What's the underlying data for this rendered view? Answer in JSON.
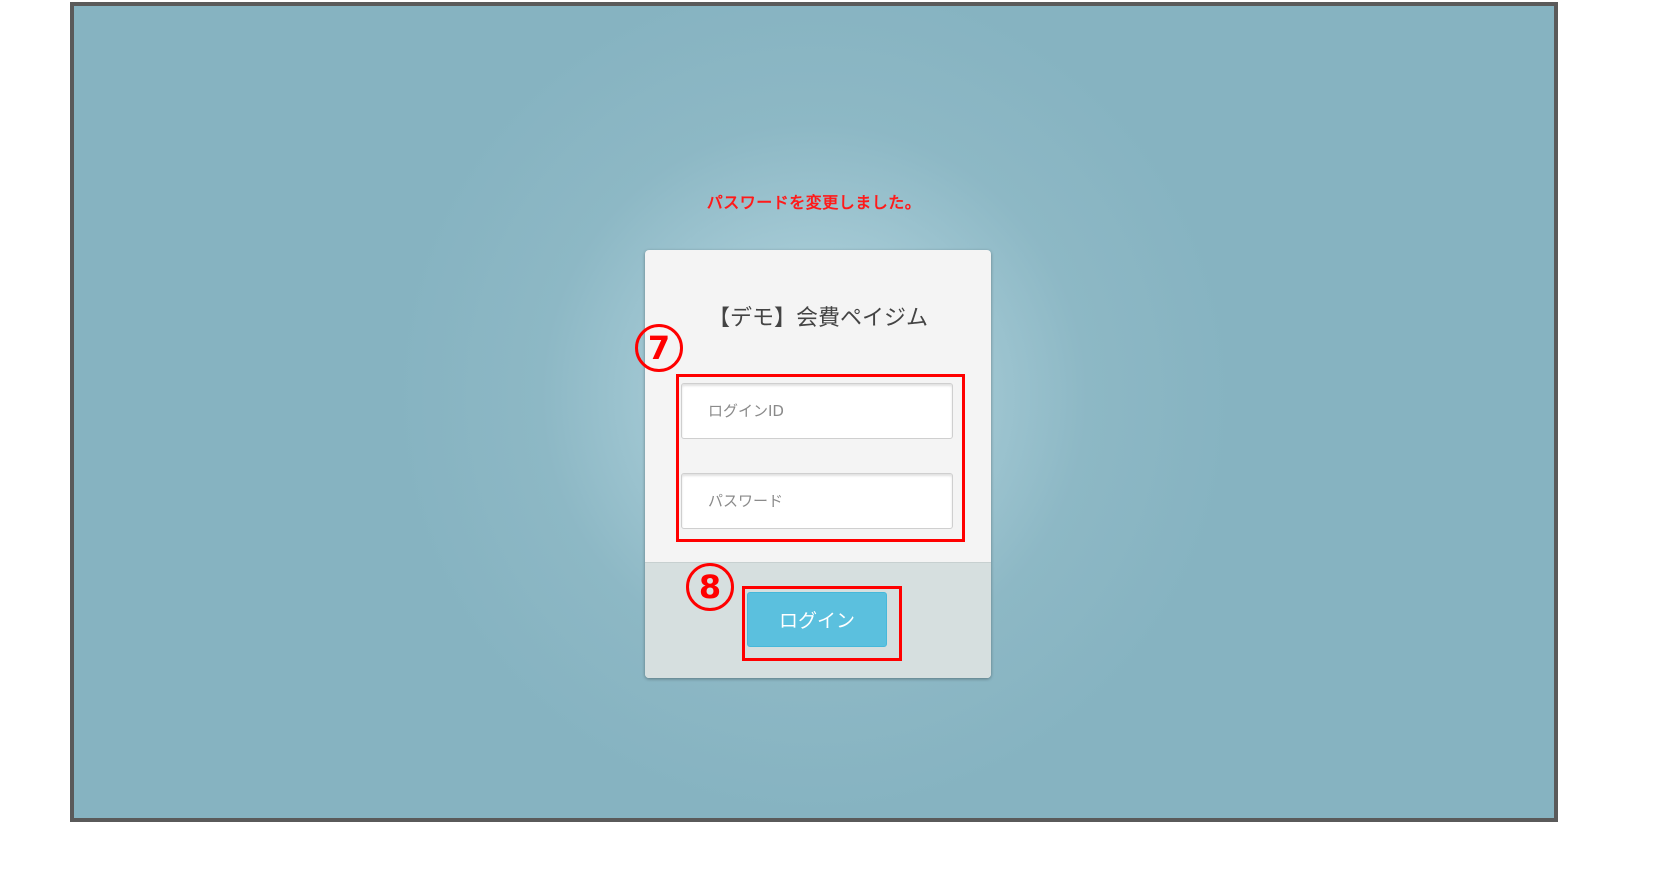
{
  "message": "パスワードを変更しました。",
  "login_card": {
    "title": "【デモ】会費ペイジム",
    "login_id_placeholder": "ログインID",
    "password_placeholder": "パスワード",
    "login_button_label": "ログイン"
  },
  "annotations": {
    "step_7": "7",
    "step_8": "8"
  },
  "colors": {
    "message": "#ff1a1a",
    "button": "#5bc0de",
    "annotation": "#ff0000",
    "background": "#8db8c5"
  }
}
